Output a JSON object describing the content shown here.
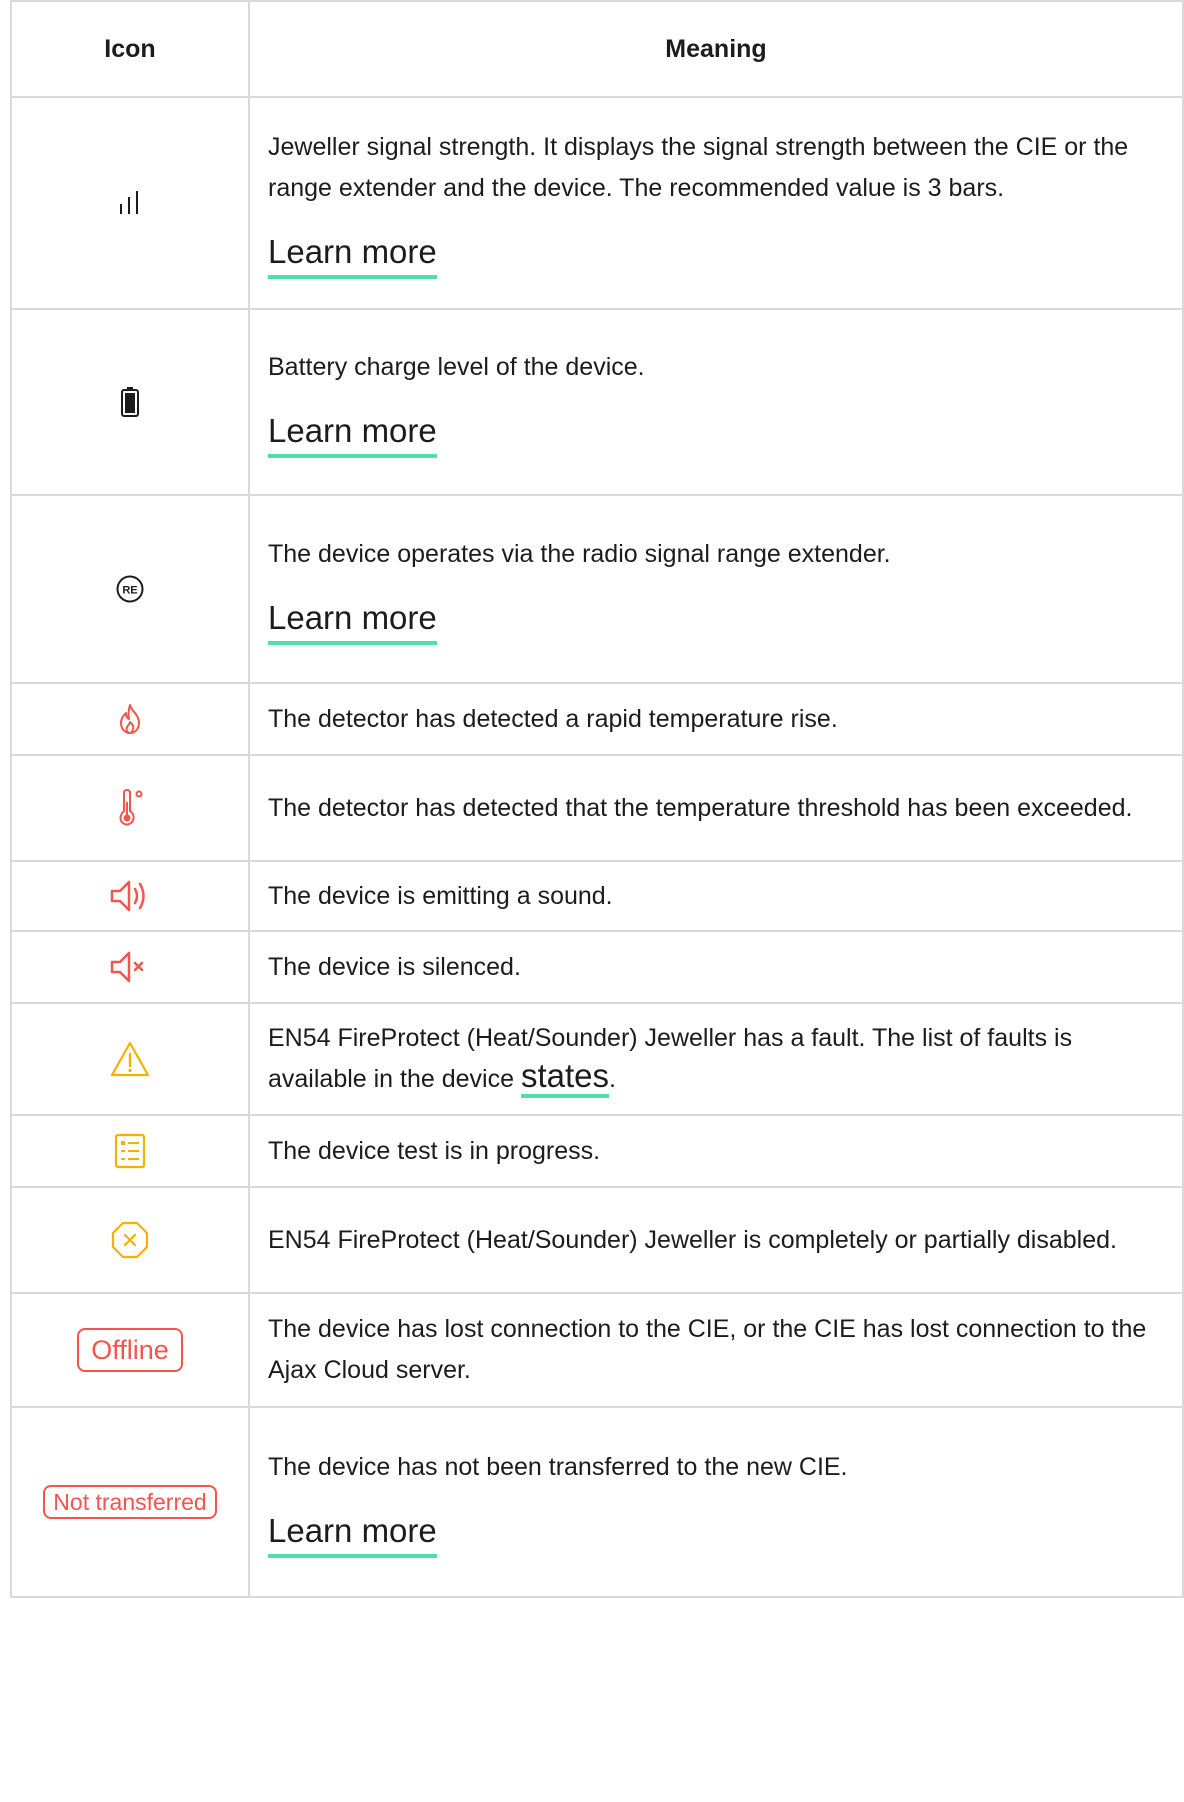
{
  "headers": {
    "icon": "Icon",
    "meaning": "Meaning"
  },
  "colors": {
    "red": "#f2554c",
    "amber": "#f6b000",
    "accent": "#4fe0a8"
  },
  "rows": [
    {
      "icon": "signal-strength-icon",
      "text": "Jeweller signal strength. It displays the signal strength between the CIE or the range extender and the device. The recommended value is 3 bars.",
      "link": "Learn more"
    },
    {
      "icon": "battery-icon",
      "text": "Battery charge level of the device.",
      "link": "Learn more"
    },
    {
      "icon": "range-extender-icon",
      "icon_text": "RE",
      "text": "The device operates via the radio signal range extender.",
      "link": "Learn more"
    },
    {
      "icon": "flame-icon",
      "text": "The detector has detected a rapid temperature rise."
    },
    {
      "icon": "thermometer-icon",
      "text": "The detector has detected that the temperature threshold has been exceeded."
    },
    {
      "icon": "speaker-sound-icon",
      "text": "The device is emitting a sound."
    },
    {
      "icon": "speaker-muted-icon",
      "text": "The device is silenced."
    },
    {
      "icon": "warning-icon",
      "text": "EN54 FireProtect (Heat/Sounder) Jeweller has a fault. The list of faults is available in the device ",
      "link": "states",
      "text_after": "."
    },
    {
      "icon": "test-checklist-icon",
      "text": "The device test is in progress."
    },
    {
      "icon": "disabled-octagon-icon",
      "text": "EN54 FireProtect (Heat/Sounder) Jeweller is completely or partially disabled."
    },
    {
      "icon": "offline-badge",
      "badge": "Offline",
      "text": "The device has lost connection to the CIE, or the CIE has lost connection to the Ajax Cloud server."
    },
    {
      "icon": "not-transferred-badge",
      "badge": "Not transferred",
      "text": "The device has not been transferred to the new CIE.",
      "link": "Learn more"
    }
  ]
}
